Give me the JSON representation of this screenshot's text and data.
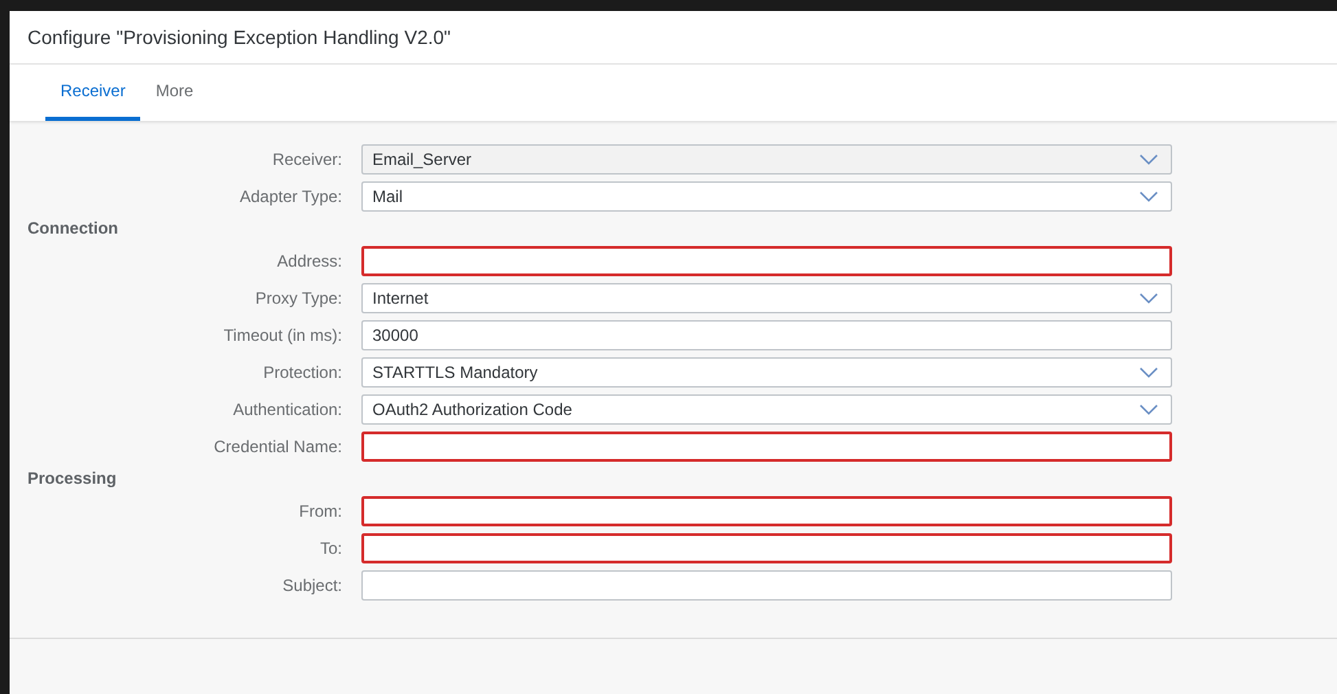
{
  "dialog": {
    "title": "Configure \"Provisioning Exception Handling V2.0\""
  },
  "tabs": [
    {
      "label": "Receiver",
      "selected": true
    },
    {
      "label": "More",
      "selected": false
    }
  ],
  "form": [
    {
      "kind": "select",
      "label": "Receiver:",
      "value": "Email_Server",
      "error": false,
      "readonly": true
    },
    {
      "kind": "select",
      "label": "Adapter Type:",
      "value": "Mail",
      "error": false,
      "readonly": false
    },
    {
      "kind": "heading",
      "label": "Connection"
    },
    {
      "kind": "input",
      "label": "Address:",
      "error": true,
      "readonly": false
    },
    {
      "kind": "select",
      "label": "Proxy Type:",
      "value": "Internet",
      "error": false,
      "readonly": false
    },
    {
      "kind": "input",
      "label": "Timeout (in ms):",
      "value": "30000",
      "error": false,
      "readonly": false
    },
    {
      "kind": "select",
      "label": "Protection:",
      "value": "STARTTLS Mandatory",
      "error": false,
      "readonly": false
    },
    {
      "kind": "select",
      "label": "Authentication:",
      "value": "OAuth2 Authorization Code",
      "error": false,
      "readonly": false
    },
    {
      "kind": "input",
      "label": "Credential Name:",
      "error": true,
      "readonly": false
    },
    {
      "kind": "heading",
      "label": "Processing"
    },
    {
      "kind": "input",
      "label": "From:",
      "error": true,
      "readonly": false
    },
    {
      "kind": "input",
      "label": "To:",
      "error": true,
      "readonly": false
    },
    {
      "kind": "input",
      "label": "Subject:",
      "error": false,
      "readonly": false
    }
  ]
}
